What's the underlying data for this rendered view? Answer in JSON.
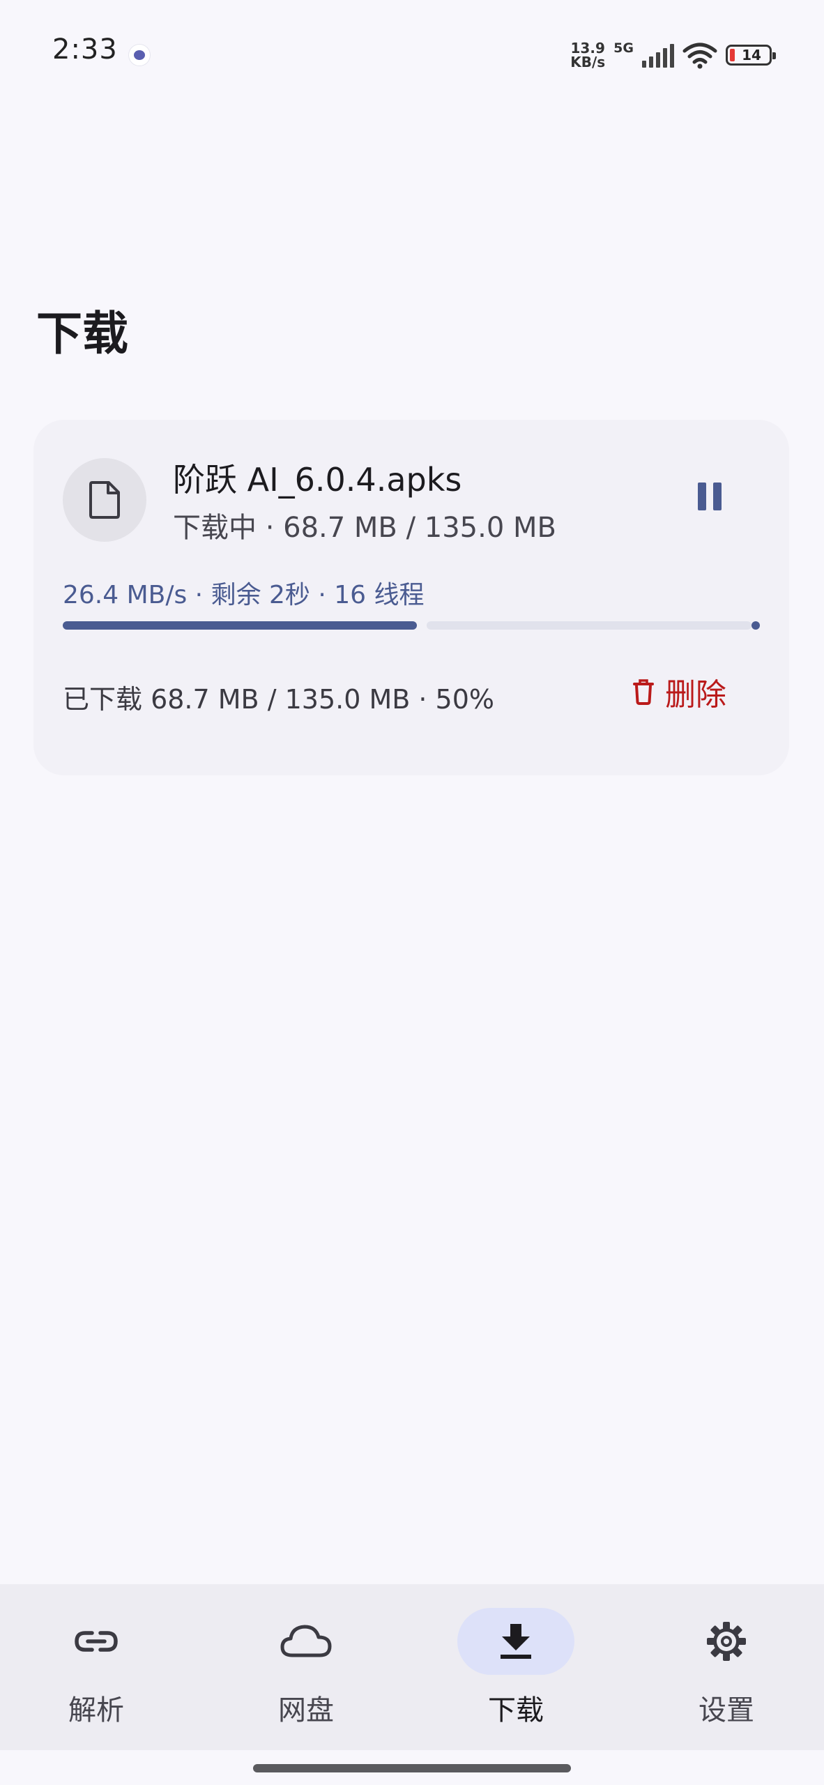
{
  "status_bar": {
    "time": "2:33",
    "net_speed_value": "13.9",
    "net_speed_unit": "KB/s",
    "network_type": "5G",
    "battery_level": "14",
    "icons": [
      "app-notification-icon",
      "signal-icon",
      "wifi-icon",
      "battery-icon"
    ]
  },
  "page": {
    "title": "下载"
  },
  "download": {
    "file_name": "阶跃 AI_6.0.4.apks",
    "status_line": "下载中 · 68.7 MB / 135.0 MB",
    "speed_line": "26.4 MB/s · 剩余 2秒 · 16 线程",
    "progress_fraction": 0.508,
    "downloaded_line": "已下载 68.7 MB / 135.0 MB · 50%",
    "delete_label": "删除",
    "icons": {
      "file": "file-icon",
      "pause": "pause-icon",
      "delete": "trash-icon"
    },
    "colors": {
      "accent": "#4a5b91",
      "danger": "#ba1a1a",
      "track": "#e1e2ec"
    }
  },
  "nav": {
    "items": [
      {
        "label": "解析",
        "icon": "link-icon",
        "active": false
      },
      {
        "label": "网盘",
        "icon": "cloud-icon",
        "active": false
      },
      {
        "label": "下载",
        "icon": "download-icon",
        "active": true
      },
      {
        "label": "设置",
        "icon": "settings-gear-icon",
        "active": false
      }
    ]
  }
}
